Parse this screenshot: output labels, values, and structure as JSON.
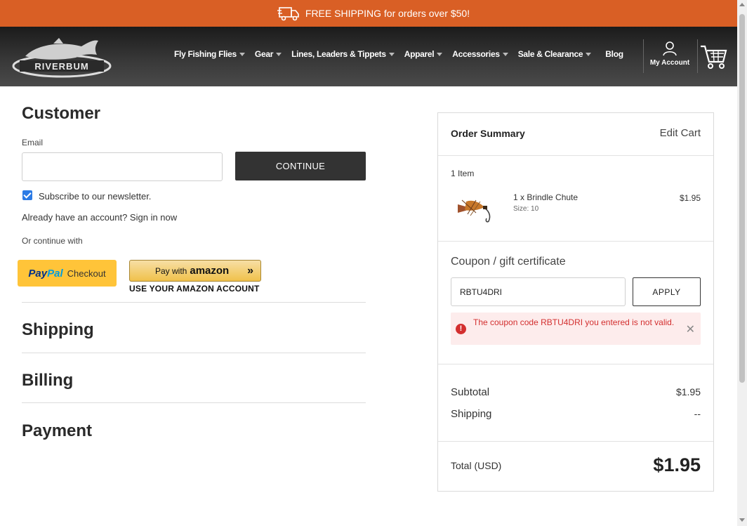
{
  "promo": {
    "text": "FREE SHIPPING for orders over $50!"
  },
  "header": {
    "logo_text": "RIVERBUM",
    "nav": [
      {
        "label": "Fly Fishing Flies",
        "has_caret": true
      },
      {
        "label": "Gear",
        "has_caret": true
      },
      {
        "label": "Lines, Leaders & Tippets",
        "has_caret": true
      },
      {
        "label": "Apparel",
        "has_caret": true
      },
      {
        "label": "Accessories",
        "has_caret": true
      },
      {
        "label": "Sale & Clearance",
        "has_caret": true
      },
      {
        "label": "Blog",
        "has_caret": false
      }
    ],
    "account_label": "My Account"
  },
  "customer": {
    "heading": "Customer",
    "email_label": "Email",
    "email_value": "",
    "continue_label": "CONTINUE",
    "newsletter_label": "Subscribe to our newsletter.",
    "newsletter_checked": true,
    "signin_text": "Already have an account? Sign in now",
    "or_continue": "Or continue with",
    "paypal_pay": "Pay",
    "paypal_pal": "Pal",
    "paypal_checkout": "Checkout",
    "amazon_pay_with": "Pay with",
    "amazon_word": "amazon",
    "amazon_sub": "USE YOUR AMAZON ACCOUNT"
  },
  "sections": {
    "shipping": "Shipping",
    "billing": "Billing",
    "payment": "Payment"
  },
  "summary": {
    "title": "Order Summary",
    "edit_cart": "Edit Cart",
    "item_count": "1 Item",
    "item_name": "1 x Brindle Chute",
    "item_size": "Size: 10",
    "item_price": "$1.95",
    "coupon_heading": "Coupon / gift certificate",
    "coupon_value": "RBTU4DRI",
    "apply_label": "APPLY",
    "error_text": "The coupon code RBTU4DRI you entered is not valid.",
    "subtotal_label": "Subtotal",
    "subtotal_value": "$1.95",
    "shipping_label": "Shipping",
    "shipping_value": "--",
    "total_label": "Total (USD)",
    "total_value": "$1.95"
  },
  "colors": {
    "promo": "#d95f25",
    "checkbox": "#2c7be5",
    "error": "#d32f2f",
    "error_bg": "#fdecec"
  }
}
